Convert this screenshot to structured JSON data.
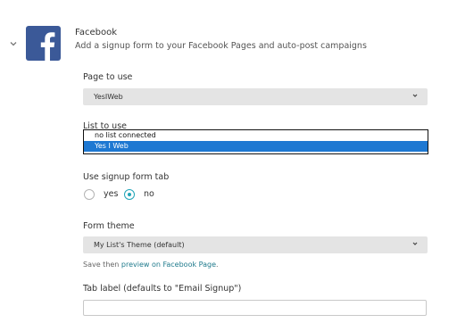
{
  "integration": {
    "title": "Facebook",
    "description": "Add a signup form to your Facebook Pages and auto-post campaigns"
  },
  "page_to_use": {
    "label": "Page to use",
    "selected": "YesIWeb"
  },
  "list_to_use": {
    "label": "List to use",
    "options": [
      "no list connected",
      "Yes I Web"
    ],
    "selected_index": 1
  },
  "signup_tab": {
    "label": "Use signup form tab",
    "options": [
      "yes",
      "no"
    ],
    "selected": "no"
  },
  "form_theme": {
    "label": "Form theme",
    "selected": "My List's Theme (default)",
    "hint_prefix": "Save then ",
    "hint_link": "preview on Facebook Page",
    "hint_suffix": "."
  },
  "tab_label": {
    "label": "Tab label (defaults to \"Email Signup\")",
    "value": ""
  },
  "colors": {
    "facebook_blue": "#3b5998",
    "accent_teal": "#21a5b8",
    "selection_blue": "#1e78d2"
  }
}
